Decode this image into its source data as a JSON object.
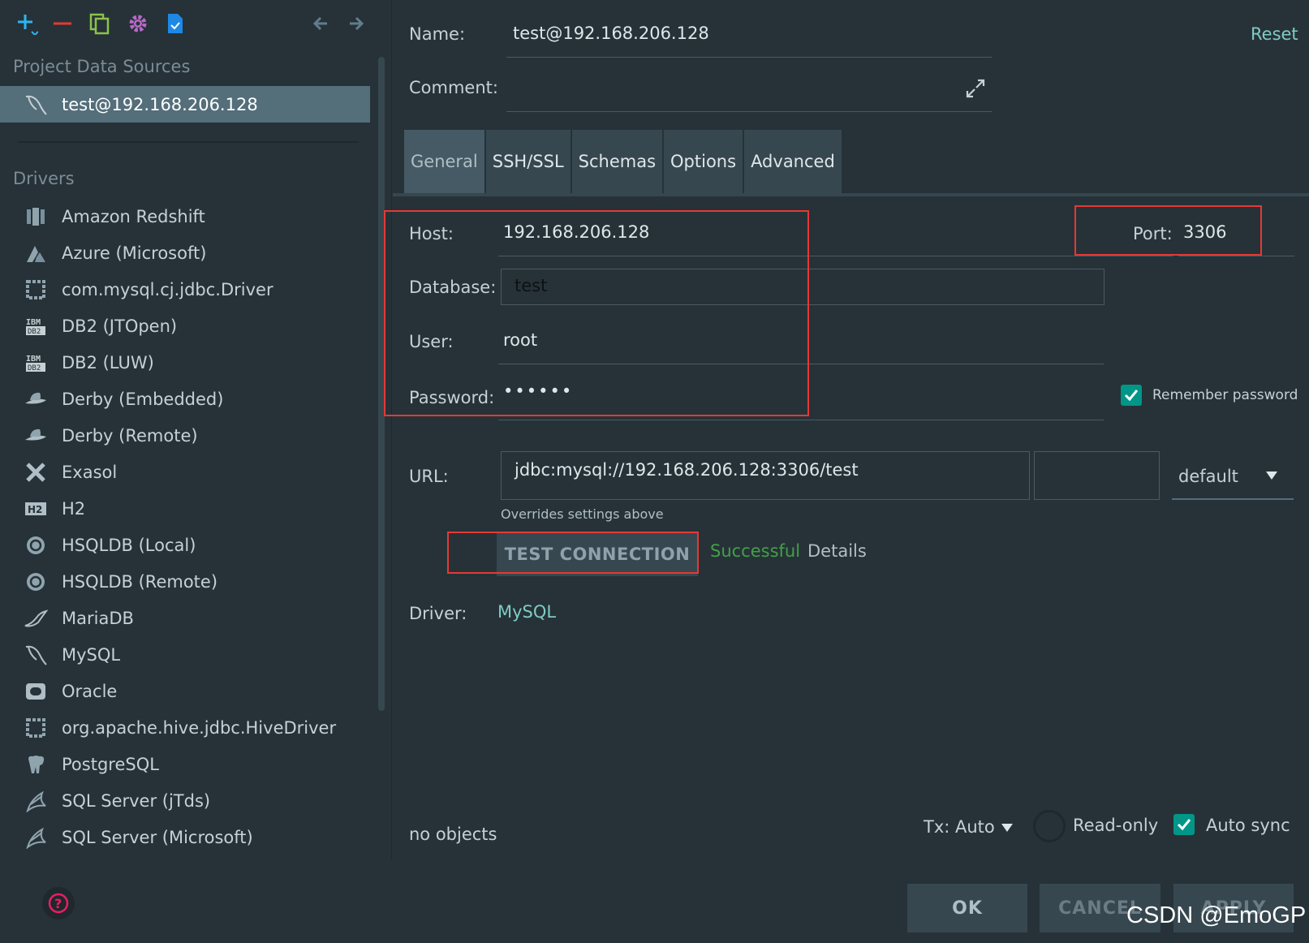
{
  "toolbar": {
    "icons": [
      "add-icon",
      "remove-icon",
      "duplicate-icon",
      "settings-icon",
      "import-icon",
      "back-arrow-icon",
      "forward-arrow-icon"
    ]
  },
  "sidebar": {
    "project_sources_label": "Project Data Sources",
    "selected_source": "test@192.168.206.128",
    "drivers_label": "Drivers",
    "drivers": [
      {
        "label": "Amazon Redshift",
        "icon": "redshift-icon"
      },
      {
        "label": "Azure (Microsoft)",
        "icon": "azure-icon"
      },
      {
        "label": "com.mysql.cj.jdbc.Driver",
        "icon": "generic-driver-icon"
      },
      {
        "label": "DB2 (JTOpen)",
        "icon": "ibm-db2-icon"
      },
      {
        "label": "DB2 (LUW)",
        "icon": "ibm-db2-icon"
      },
      {
        "label": "Derby (Embedded)",
        "icon": "derby-hat-icon"
      },
      {
        "label": "Derby (Remote)",
        "icon": "derby-hat-icon"
      },
      {
        "label": "Exasol",
        "icon": "exasol-icon"
      },
      {
        "label": "H2",
        "icon": "h2-icon"
      },
      {
        "label": "HSQLDB (Local)",
        "icon": "hsqldb-icon"
      },
      {
        "label": "HSQLDB (Remote)",
        "icon": "hsqldb-icon"
      },
      {
        "label": "MariaDB",
        "icon": "mariadb-icon"
      },
      {
        "label": "MySQL",
        "icon": "mysql-dolphin-icon"
      },
      {
        "label": "Oracle",
        "icon": "oracle-icon"
      },
      {
        "label": "org.apache.hive.jdbc.HiveDriver",
        "icon": "generic-driver-icon"
      },
      {
        "label": "PostgreSQL",
        "icon": "postgresql-elephant-icon"
      },
      {
        "label": "SQL Server (jTds)",
        "icon": "sqlserver-icon"
      },
      {
        "label": "SQL Server (Microsoft)",
        "icon": "sqlserver-icon"
      }
    ]
  },
  "form": {
    "name_label": "Name:",
    "name_value": "test@192.168.206.128",
    "reset_label": "Reset",
    "comment_label": "Comment:",
    "comment_value": "",
    "tabs": [
      "General",
      "SSH/SSL",
      "Schemas",
      "Options",
      "Advanced"
    ],
    "active_tab": "General",
    "host_label": "Host:",
    "host_value": "192.168.206.128",
    "port_label": "Port:",
    "port_value": "3306",
    "database_label": "Database:",
    "database_value": "test",
    "user_label": "User:",
    "user_value": "root",
    "password_label": "Password:",
    "password_value": "••••••",
    "remember_password_label": "Remember password",
    "remember_password_checked": true,
    "url_label": "URL:",
    "url_value": "jdbc:mysql://192.168.206.128:3306/test",
    "url_mode": "default",
    "url_hint": "Overrides settings above",
    "test_connection_label": "TEST CONNECTION",
    "test_status": "Successful",
    "details_label": "Details",
    "driver_label": "Driver:",
    "driver_value": "MySQL",
    "objects_status": "no objects",
    "tx_label": "Tx: Auto",
    "readonly_label": "Read-only",
    "readonly_checked": false,
    "autosync_label": "Auto sync",
    "autosync_checked": true
  },
  "buttons": {
    "ok": "OK",
    "cancel": "CANCEL",
    "apply": "APPLY"
  },
  "watermark": "CSDN @EmoGP",
  "colors": {
    "background": "#263238",
    "selection": "#546e7a",
    "accent": "#80cbc4",
    "success": "#4caf50",
    "highlight_box": "#e53935",
    "checkbox": "#009688"
  }
}
